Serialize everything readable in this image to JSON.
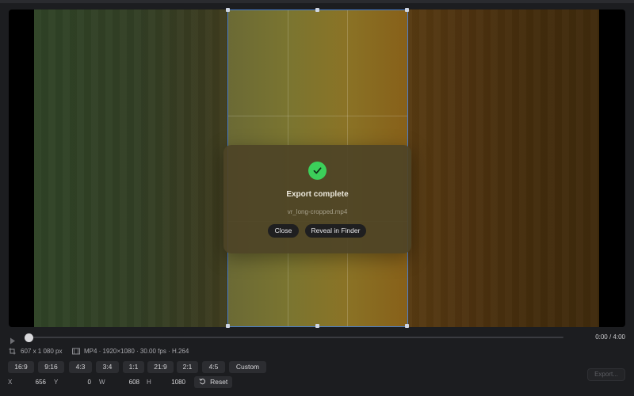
{
  "dialog": {
    "title": "Export complete",
    "filename": "vr_long-cropped.mp4",
    "close_label": "Close",
    "reveal_label": "Reveal in Finder",
    "success_color": "#3ccf5a"
  },
  "player": {
    "timecode": "0:00 / 4:00",
    "progress": 0
  },
  "info": {
    "crop_size": "607 x 1 080 px",
    "source": "MP4 · 1920×1080 · 30.00 fps · H.264"
  },
  "ratios": [
    "16:9",
    "9:16",
    "4:3",
    "3:4",
    "1:1",
    "21:9",
    "2:1",
    "4:5",
    "Custom"
  ],
  "coords": {
    "x_label": "X",
    "x_value": "656",
    "y_label": "Y",
    "y_value": "0",
    "w_label": "W",
    "w_value": "608",
    "h_label": "H",
    "h_value": "1080",
    "reset_label": "Reset"
  },
  "export_label": "Export...",
  "colors": {
    "accent": "#4a7fd0",
    "background": "#1c1d20"
  },
  "icons": {
    "play": "play-icon",
    "crop": "crop-icon",
    "film": "film-icon",
    "reset": "rotate-ccw-icon",
    "check": "checkmark-icon"
  }
}
